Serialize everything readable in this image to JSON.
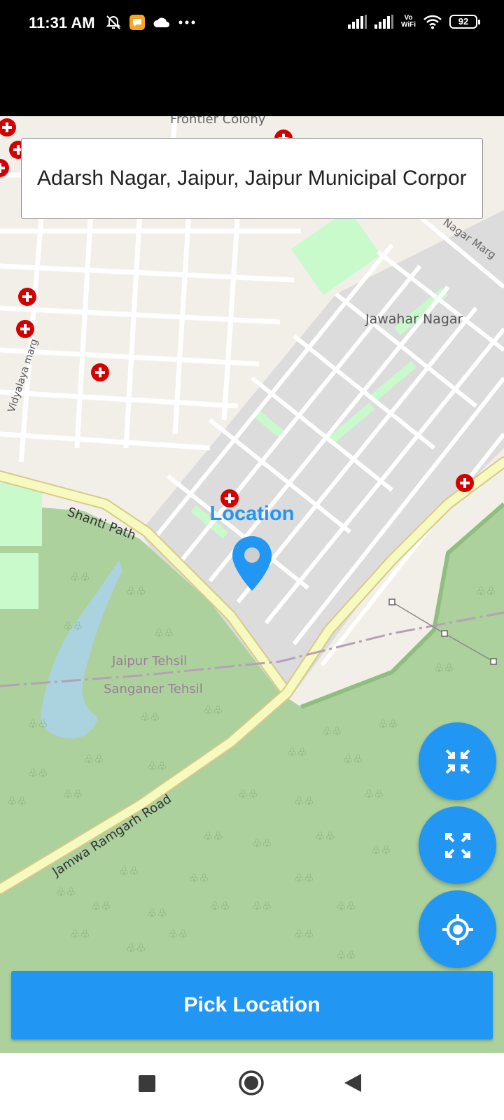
{
  "status_bar": {
    "time": "11:31 AM",
    "left_icons": [
      "alarm-off-icon",
      "message-notification-icon",
      "cloud-icon",
      "more-dots-icon"
    ],
    "right_icons": [
      "signal-icon",
      "signal-icon",
      "vowifi-icon",
      "wifi-icon",
      "battery-icon"
    ],
    "vowifi_line1": "Vo",
    "vowifi_line2": "WiFi",
    "battery_level": "92"
  },
  "map": {
    "place_labels": [
      "Frontier Colony",
      "Jawahar Nagar",
      "Nagar Marg",
      "Vidyalaya marg",
      "Shanti Path",
      "Jaipur Tehsil",
      "Sanganer Tehsil",
      "Jamwa Ramgarh Road"
    ],
    "marker_label": "Location",
    "marker_icon": "map-pin-icon"
  },
  "search": {
    "value": "Adarsh Nagar, Jaipur, Jaipur Municipal Corporation, Jaipur, Rajasthan"
  },
  "fabs": [
    {
      "icon": "collapse-icon"
    },
    {
      "icon": "expand-icon"
    },
    {
      "icon": "my-location-icon"
    }
  ],
  "pick_button": {
    "label": "Pick Location"
  },
  "nav_bar": {
    "icons": [
      "recents-square-icon",
      "home-circle-icon",
      "back-triangle-icon"
    ]
  },
  "colors": {
    "accent": "#2196f3",
    "map_background": "#f2efe9",
    "park_green": "#acd19d",
    "road_yellow": "#f7fabf",
    "hospital_red": "#d40000"
  }
}
